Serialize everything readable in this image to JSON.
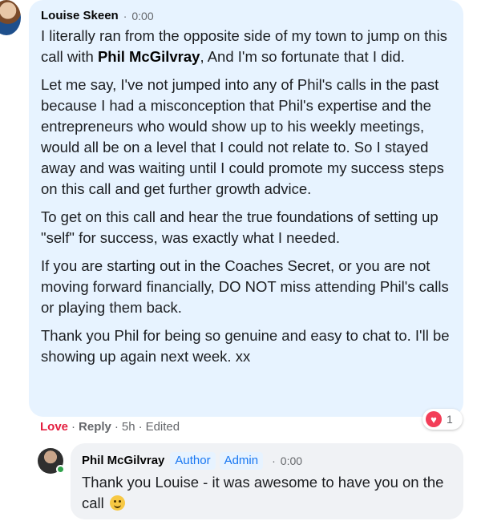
{
  "comment": {
    "author": "Louise Skeen",
    "separator": "·",
    "time": "0:00",
    "paragraphs": [
      {
        "before": "I literally ran from the opposite side of my town to jump on this call with ",
        "mention": "Phil McGilvray",
        "after": ", And I'm so fortunate that I did."
      },
      "Let me say, I've not jumped into any of Phil's calls in the past because I had a misconception that Phil's expertise and the entrepreneurs who would show up to his weekly meetings, would all be on a level that I could not relate to. So I stayed away and was waiting until I could promote my success steps on this call and get further growth advice.",
      "To get on this call and hear the true foundations of setting up \"self\" for success, was exactly what I needed.",
      "If you are starting out in the Coaches Secret, or you are not moving forward financially, DO NOT miss attending Phil's calls or playing them back.",
      "Thank you Phil for being so genuine and easy to chat to. I'll be showing up again next week. xx"
    ],
    "actions": {
      "love": "Love",
      "reply": "Reply",
      "age": "5h",
      "edited": "Edited",
      "sep": "·"
    },
    "reaction": {
      "icon": "heart-icon",
      "count": "1",
      "color": "#f33e58"
    }
  },
  "reply": {
    "author": "Phil McGilvray",
    "tags": [
      "Author",
      "Admin"
    ],
    "separator": "·",
    "time": "0:00",
    "text": "Thank you Louise - it was awesome to have you on the call",
    "emoji": "smiley-icon"
  },
  "colors": {
    "comment_bubble": "#e7f3ff",
    "reply_bubble": "#f0f2f5",
    "love": "#e41e3f",
    "tag_text": "#1877f2",
    "online": "#31a24c"
  }
}
